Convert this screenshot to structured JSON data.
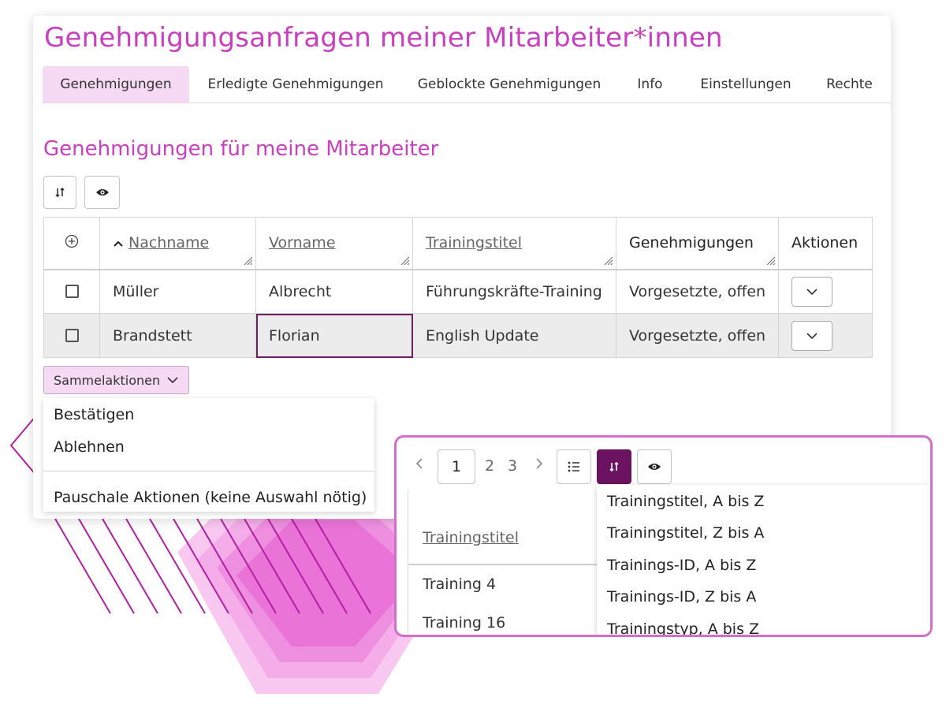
{
  "page_title": "Genehmigungsanfragen meiner Mitarbeiter*innen",
  "tabs": [
    {
      "label": "Genehmigungen",
      "active": true
    },
    {
      "label": "Erledigte Genehmigungen",
      "active": false
    },
    {
      "label": "Geblockte Genehmigungen",
      "active": false
    },
    {
      "label": "Info",
      "active": false
    },
    {
      "label": "Einstellungen",
      "active": false
    },
    {
      "label": "Rechte",
      "active": false
    }
  ],
  "section_title": "Genehmigungen für meine Mitarbeiter",
  "toolbar": {
    "sort_icon": "sort-icon",
    "view_icon": "eye-icon"
  },
  "table": {
    "columns": [
      "Nachname",
      "Vorname",
      "Trainingstitel",
      "Genehmigungen",
      "Aktionen"
    ],
    "rows": [
      {
        "nachname": "Müller",
        "vorname": "Albrecht",
        "trainingstitel": "Führungskräfte-Training",
        "genehmigungen": "Vorgesetzte, offen"
      },
      {
        "nachname": "Brandstett",
        "vorname": "Florian",
        "trainingstitel": "English Update",
        "genehmigungen": "Vorgesetzte, offen"
      }
    ]
  },
  "bulk_actions": {
    "label": "Sammelaktionen",
    "items": [
      "Bestätigen",
      "Ablehnen"
    ],
    "global_item": "Pauschale Aktionen (keine Auswahl nötig)"
  },
  "overlay": {
    "pagination": {
      "prev": "‹",
      "current": "1",
      "pages": [
        "2",
        "3"
      ],
      "next": "›"
    },
    "table_header": "Trainingstitel",
    "rows": [
      "Training 4",
      "Training 16"
    ],
    "sort_options": [
      "Trainingstitel, A bis Z",
      "Trainingstitel, Z bis A",
      "Trainings-ID, A bis Z",
      "Trainings-ID, Z bis A",
      "Trainingstyp, A bis Z"
    ]
  },
  "colors": {
    "accent": "#c93fc0",
    "tab_active": "#f6d9f2",
    "dark_button": "#6b1261",
    "overlay_border": "#d36fcb"
  }
}
